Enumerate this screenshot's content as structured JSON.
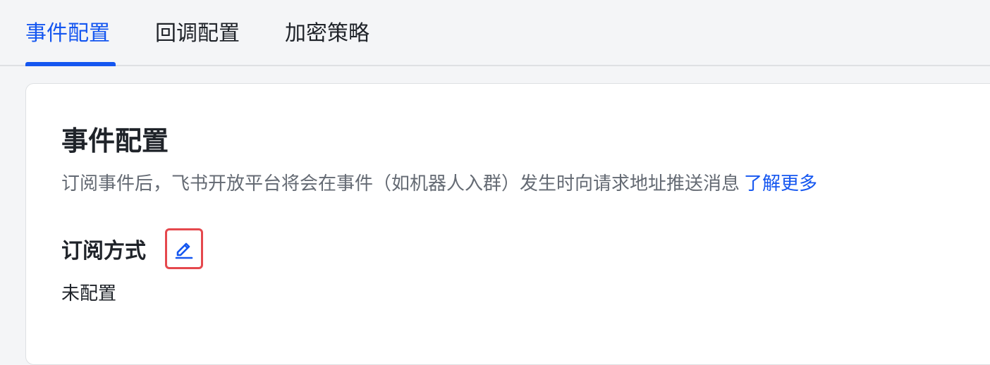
{
  "tabs": [
    {
      "label": "事件配置",
      "active": true
    },
    {
      "label": "回调配置",
      "active": false
    },
    {
      "label": "加密策略",
      "active": false
    }
  ],
  "card": {
    "title": "事件配置",
    "description": "订阅事件后，飞书开放平台将会在事件（如机器人入群）发生时向请求地址推送消息",
    "learn_more": "了解更多",
    "subscription": {
      "label": "订阅方式",
      "edit_icon": "pencil-icon",
      "value": "未配置"
    }
  },
  "colors": {
    "accent": "#1456f0",
    "highlight_border": "#e5484d",
    "text_secondary": "#646a73"
  }
}
